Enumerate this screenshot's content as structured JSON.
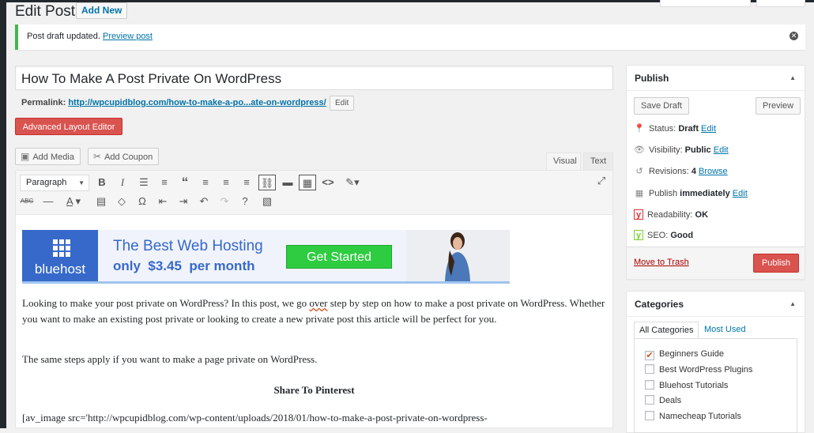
{
  "header": {
    "title": "Edit Post",
    "add_new": "Add New"
  },
  "notice": {
    "text": "Post draft updated.",
    "link": "Preview post"
  },
  "post": {
    "title": "How To Make A Post Private On WordPress",
    "permalink_label": "Permalink:",
    "permalink_url": "http://wpcupidblog.com/how-to-make-a-po...ate-on-wordpress/",
    "permalink_edit": "Edit"
  },
  "buttons": {
    "advanced_layout_editor": "Advanced Layout Editor",
    "add_media": "Add Media",
    "add_coupon": "Add Coupon"
  },
  "editor_tabs": {
    "visual": "Visual",
    "text": "Text"
  },
  "toolbar": {
    "format": "Paragraph",
    "horizontal_icon": "—",
    "omega": "Ω"
  },
  "banner": {
    "brand": "bluehost",
    "line1": "The Best Web Hosting",
    "line2": "only  $3.45  per month",
    "cta": "Get Started"
  },
  "content": {
    "p1": "Looking to make your post private on WordPress? In this post, we go ",
    "p1_spell": "over",
    "p1_rest": " step by step on how to make a post private on WordPress. Whether you want to make an existing post private or looking to create a new private post this article will be perfect for you.",
    "p2": "The same steps apply if you want to make a page private on WordPress.",
    "heading": "Share To Pinterest",
    "p3": "[av_image src='http://wpcupidblog.com/wp-content/uploads/2018/01/how-to-make-a-post-private-on-wordpress-"
  },
  "publish": {
    "title": "Publish",
    "save_draft": "Save Draft",
    "preview": "Preview",
    "status_label": "Status:",
    "status_value": "Draft",
    "visibility_label": "Visibility:",
    "visibility_value": "Public",
    "revisions_label": "Revisions:",
    "revisions_value": "4",
    "revisions_link": "Browse",
    "publish_label": "Publish",
    "publish_value": "immediately",
    "edit": "Edit",
    "readability_label": "Readability:",
    "readability_value": "OK",
    "seo_label": "SEO:",
    "seo_value": "Good",
    "trash": "Move to Trash",
    "publish_button": "Publish",
    "readability_color": "#dc3232",
    "seo_color": "#7ad03a"
  },
  "categories": {
    "title": "Categories",
    "tab_all": "All Categories",
    "tab_used": "Most Used",
    "items": [
      {
        "label": "Beginners Guide",
        "checked": true
      },
      {
        "label": "Best WordPress Plugins",
        "checked": false
      },
      {
        "label": "Bluehost Tutorials",
        "checked": false
      },
      {
        "label": "Deals",
        "checked": false
      },
      {
        "label": "Namecheap Tutorials",
        "checked": false
      }
    ]
  },
  "colors": {
    "accent": "#0073aa",
    "danger": "#d9534f",
    "notice": "#46b450"
  }
}
